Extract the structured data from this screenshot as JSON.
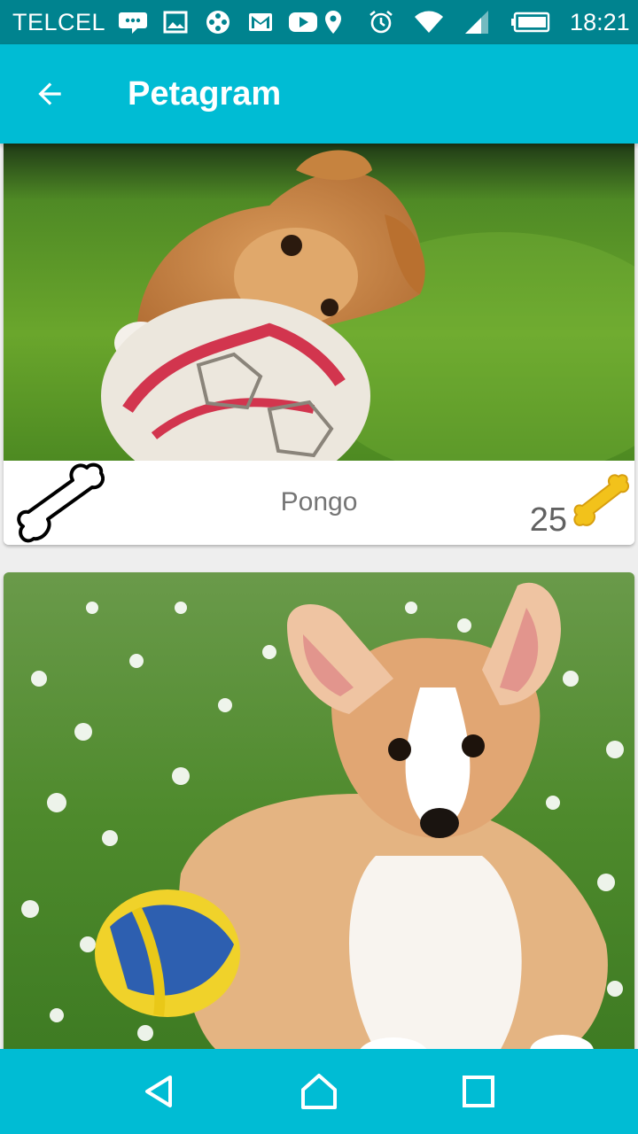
{
  "status_bar": {
    "carrier": "TELCEL",
    "time": "18:21",
    "left_icons": [
      "messaging-icon",
      "gallery-icon",
      "video-reel-icon",
      "gmail-icon",
      "youtube-icon"
    ],
    "right_icons": [
      "location-icon",
      "alarm-icon",
      "wifi-icon",
      "signal-icon",
      "battery-icon"
    ]
  },
  "app_bar": {
    "title": "Petagram",
    "back_icon": "arrow-back-icon"
  },
  "pets": [
    {
      "name": "Pongo",
      "likes": "25",
      "photo": "puppy-with-soccer-ball",
      "like_icon": "bone-outline-icon",
      "rating_icon": "bone-filled-icon"
    },
    {
      "name": "",
      "photo": "corgi-puppy-with-ball"
    }
  ],
  "nav_bar": {
    "buttons": [
      "back-triangle-icon",
      "home-icon",
      "recents-icon"
    ]
  },
  "colors": {
    "status_bar": "#00838f",
    "app_bar": "#00bcd4",
    "nav_bar": "#00bcd4",
    "background": "#eeeeee",
    "bone_gold": "#f2c21b"
  }
}
